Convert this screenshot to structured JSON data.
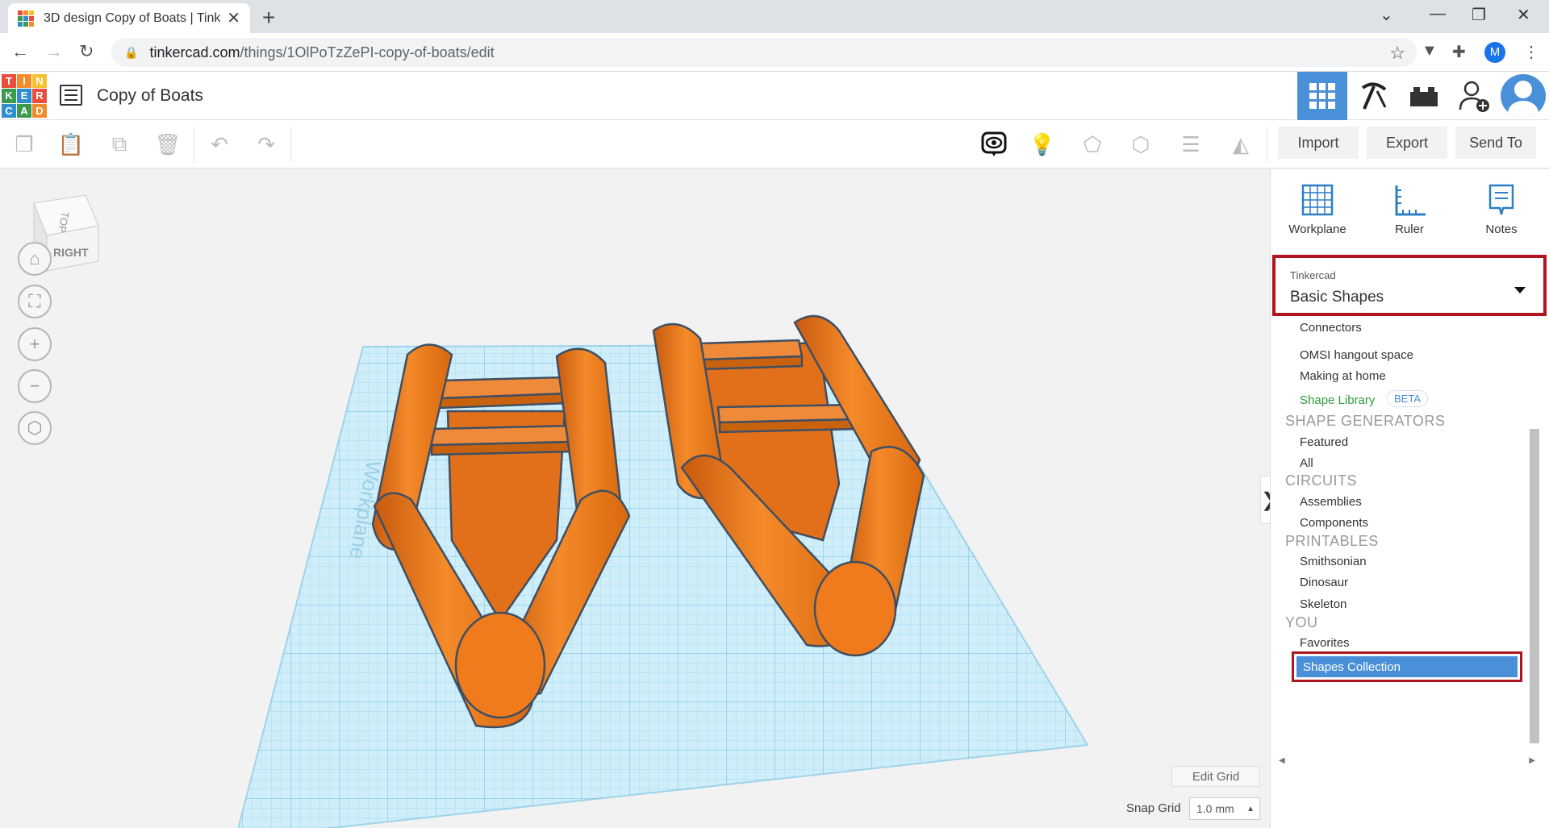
{
  "browser": {
    "tab_title": "3D design Copy of Boats | Tinkercad",
    "url_host": "tinkercad.com",
    "url_path": "/things/1OlPoTzZePI-copy-of-boats/edit",
    "profile_initial": "M"
  },
  "app": {
    "logo_letters": [
      "T",
      "I",
      "N",
      "K",
      "E",
      "R",
      "C",
      "A",
      "D"
    ],
    "logo_colors": [
      "#e94e3d",
      "#f48b2a",
      "#f5c22d",
      "#3c9a4c",
      "#2e8fd0",
      "#e94e3d",
      "#2e8fd0",
      "#3c9a4c",
      "#f48b2a"
    ],
    "doc_title": "Copy of Boats",
    "accent": "#4a90d9"
  },
  "toolbar": {
    "import_label": "Import",
    "export_label": "Export",
    "send_to_label": "Send To"
  },
  "viewport": {
    "viewcube_top": "TOP",
    "viewcube_right": "RIGHT",
    "workplane_label": "Workplane",
    "edit_grid_label": "Edit Grid",
    "snap_grid_label": "Snap Grid",
    "snap_grid_value": "1.0 mm",
    "shape_color": "#f07b1d",
    "plane_color": "#a8dcf0"
  },
  "right_panel": {
    "tools": [
      {
        "label": "Workplane",
        "icon": "workplane-icon"
      },
      {
        "label": "Ruler",
        "icon": "ruler-icon"
      },
      {
        "label": "Notes",
        "icon": "notes-icon"
      }
    ],
    "library_provider": "Tinkercad",
    "library_selected": "Basic Shapes",
    "items": {
      "connectors": "Connectors",
      "omsi": "OMSI hangout space",
      "making": "Making at home",
      "shape_library": "Shape Library",
      "beta": "BETA",
      "gen_head": "SHAPE GENERATORS",
      "featured": "Featured",
      "all": "All",
      "circuits_head": "CIRCUITS",
      "assemblies": "Assemblies",
      "components": "Components",
      "printables_head": "PRINTABLES",
      "smithsonian": "Smithsonian",
      "dinosaur": "Dinosaur",
      "skeleton": "Skeleton",
      "you_head": "YOU",
      "favorites": "Favorites",
      "shapes_collection": "Shapes Collection"
    }
  }
}
